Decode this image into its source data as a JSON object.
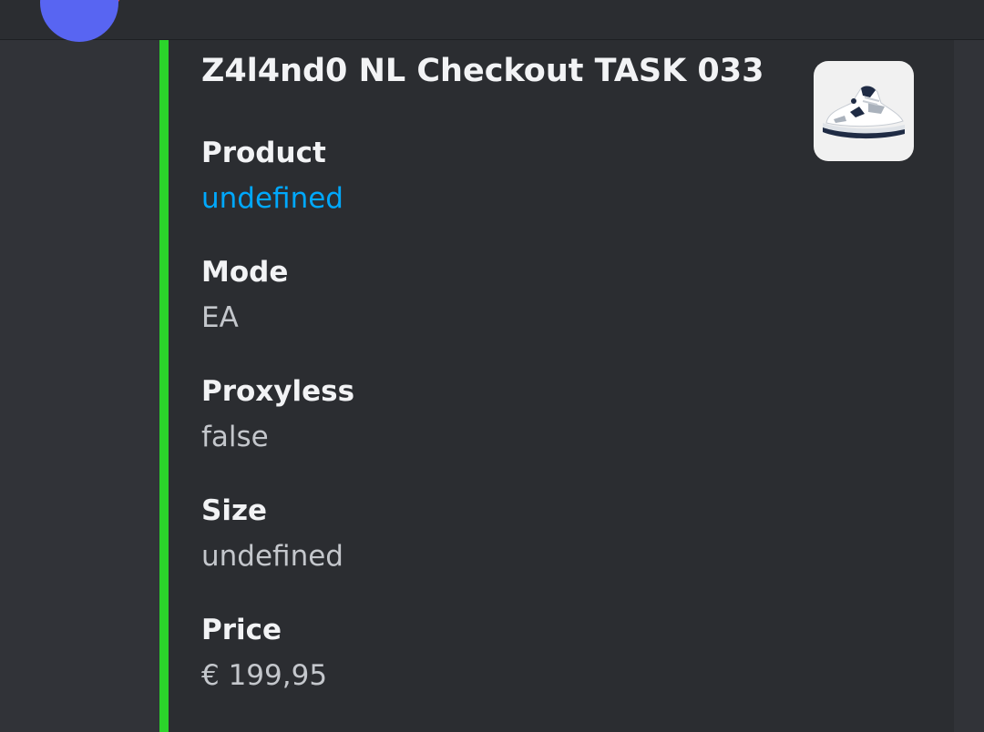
{
  "embed": {
    "title": "Z4l4nd0 NL Checkout TASK 033",
    "accent_color": "#2bd42b",
    "thumbnail_icon": "sneaker-icon",
    "fields": [
      {
        "name": "Product",
        "value": "undefined",
        "is_link": true
      },
      {
        "name": "Mode",
        "value": "EA",
        "is_link": false
      },
      {
        "name": "Proxyless",
        "value": "false",
        "is_link": false
      },
      {
        "name": "Size",
        "value": "undefined",
        "is_link": false
      },
      {
        "name": "Price",
        "value": "€ 199,95",
        "is_link": false
      }
    ]
  },
  "colors": {
    "background": "#313338",
    "embed_background": "#2b2d31",
    "link": "#00a8fc",
    "avatar": "#5865f2",
    "notification": "#ed4245"
  }
}
